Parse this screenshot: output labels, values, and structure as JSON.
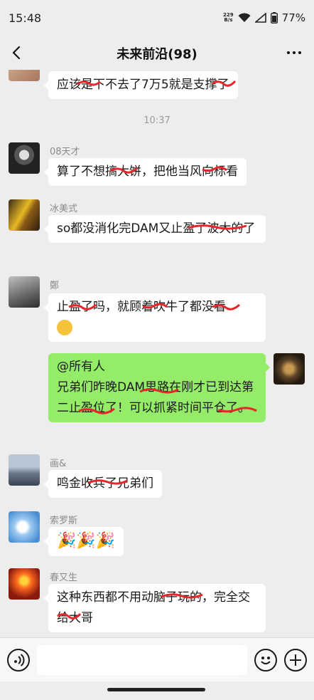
{
  "status_bar": {
    "time": "15:48",
    "net_speed_top": "229",
    "net_speed_bottom": "B/s",
    "battery": "77%"
  },
  "header": {
    "title": "未来前沿(98)"
  },
  "messages": [
    {
      "text": "应该是下不去了7万5就是支撑了"
    },
    {
      "time": "10:37"
    },
    {
      "sender": "08天才",
      "text": "算了不想搞大饼，把他当风向标看"
    },
    {
      "sender": "冰美式",
      "text": "so都没消化完DAM又止盈了波大的了"
    },
    {
      "sender": "鄭",
      "text": "止盈了吗，就顾着吹牛了都没看"
    },
    {
      "mention": "@所有人",
      "text": "兄弟们昨晚DAM思路在刚才已到达第二止盈位了！可以抓紧时间平仓了。"
    },
    {
      "sender": "画&",
      "text": "鸣金收兵了兄弟们"
    },
    {
      "sender": "索罗斯",
      "text": "🎉🎉🎉"
    },
    {
      "sender": "春又生",
      "text": "这种东西都不用动脑子玩的，完全交给大哥"
    }
  ],
  "icons": {
    "back": "chevron-left-icon",
    "more": "more-dots-icon",
    "voice": "voice-icon",
    "emoji": "emoji-icon",
    "plus": "plus-icon"
  },
  "colors": {
    "background": "#ededed",
    "bubble_in": "#ffffff",
    "bubble_out": "#95ec69",
    "scribble": "#e8262a"
  }
}
